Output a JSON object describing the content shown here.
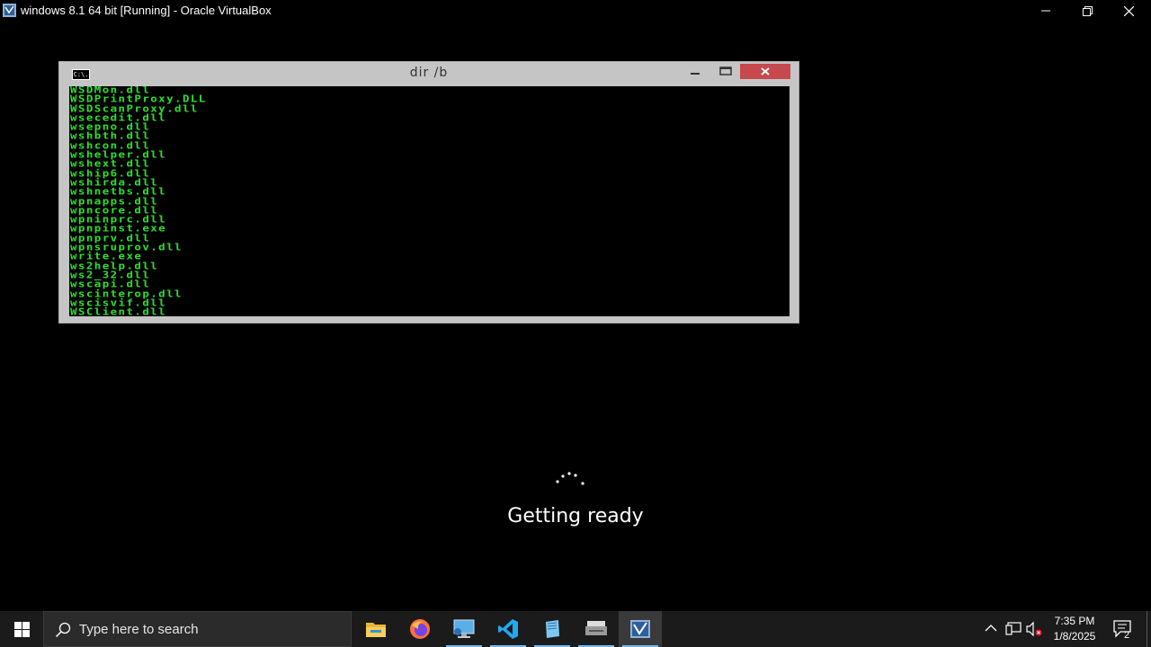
{
  "host": {
    "title": "windows 8.1 64 bit [Running] - Oracle VirtualBox",
    "app_icon": "virtualbox-icon",
    "controls": [
      "minimize-icon",
      "restore-icon",
      "close-icon"
    ]
  },
  "cmd_window": {
    "icon_text": "C:\\.",
    "title": "dir /b",
    "lines": [
      "WSDMon.dll",
      "WSDPrintProxy.DLL",
      "WSDScanProxy.dll",
      "wsecedit.dll",
      "wsepno.dll",
      "wshbth.dll",
      "wshcon.dll",
      "wshelper.dll",
      "wshext.dll",
      "wship6.dll",
      "wshirda.dll",
      "wshnetbs.dll",
      "wpnapps.dll",
      "wpncore.dll",
      "wpninprc.dll",
      "wpnpinst.exe",
      "wpnprv.dll",
      "wpnsruprov.dll",
      "write.exe",
      "ws2help.dll",
      "ws2_32.dll",
      "wscapi.dll",
      "wscinterop.dll",
      "wscisvif.dll",
      "WSClient.dll"
    ],
    "colors": {
      "text": "#2ee02e",
      "close": "#c7484d"
    }
  },
  "setup": {
    "message": "Getting ready"
  },
  "taskbar": {
    "search_placeholder": "Type here to search",
    "apps": [
      "file-explorer-icon",
      "firefox-icon",
      "remote-desktop-icon",
      "vscode-icon",
      "notepad-icon",
      "scanner-icon",
      "virtualbox-icon"
    ],
    "clock_time": "7:35 PM",
    "clock_date": "1/8/2025",
    "notification_count": "2"
  }
}
